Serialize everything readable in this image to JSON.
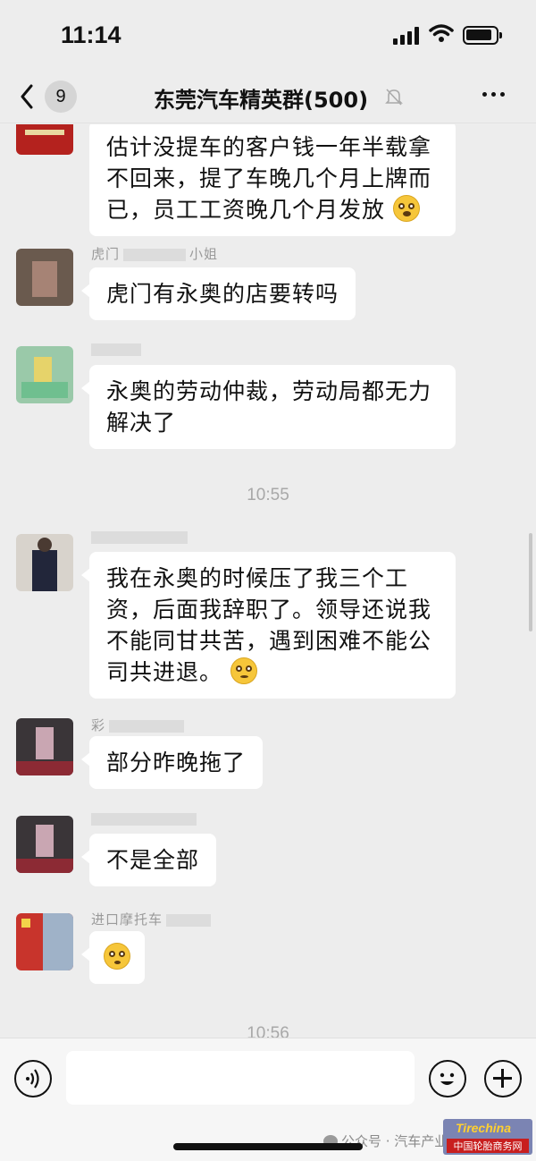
{
  "status": {
    "time": "11:14"
  },
  "nav": {
    "unread": "9",
    "title": "东莞汽车精英群(500)"
  },
  "chat": {
    "messages": [
      {
        "sender": "",
        "lines": [
          "估计没提车的客户钱一年半载拿",
          "不回来，提了车晚几个月上牌而",
          "已，员工工资晚几个月发放"
        ],
        "trailing_emoji": "cry-laugh-emoji"
      },
      {
        "sender": "虎门",
        "sender_tail": "小姐",
        "lines": [
          "虎门有永奥的店要转吗"
        ]
      },
      {
        "sender": "",
        "lines": [
          "永奥的劳动仲裁，劳动局都无力",
          "解决了"
        ]
      },
      {
        "sender": "",
        "lines": [
          "我在永奥的时候压了我三个工",
          "资，后面我辞职了。领导还说我",
          "不能同甘共苦，遇到困难不能公",
          "司共进退。"
        ],
        "trailing_emoji": "pleading-emoji"
      },
      {
        "sender": "彩",
        "lines": [
          "部分昨晚拖了"
        ]
      },
      {
        "sender": "",
        "lines": [
          "不是全部"
        ]
      },
      {
        "sender": "进口摩托车",
        "lines": [],
        "trailing_emoji": "flushed-emoji"
      }
    ],
    "timestamps": [
      "10:55",
      "10:56"
    ]
  },
  "input": {
    "placeholder": ""
  },
  "watermark": {
    "text": "公众号 · 汽车产业",
    "logo_top": "Tirechina",
    "logo_bottom": "中国轮胎商务网"
  }
}
